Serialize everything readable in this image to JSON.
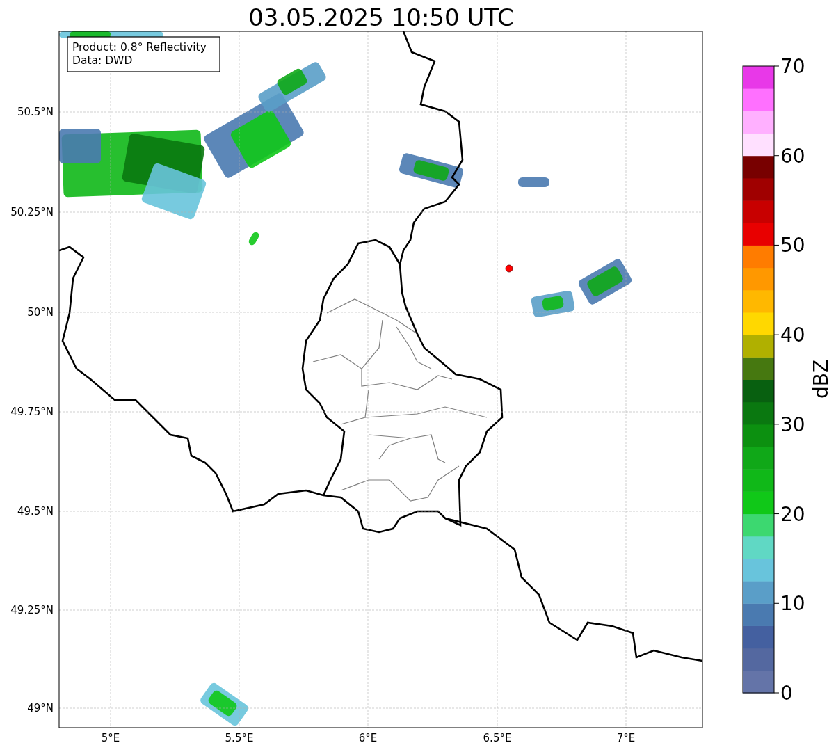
{
  "title": "03.05.2025 10:50 UTC",
  "info_box": [
    "Product: 0.8° Reflectivity",
    "Data: DWD"
  ],
  "lat_labels": [
    "50.5°N",
    "50.25°N",
    "50°N",
    "49.75°N",
    "49.5°N",
    "49.25°N",
    "49°N"
  ],
  "lon_labels": [
    "5°E",
    "5.5°E",
    "6°E",
    "6.5°E",
    "7°E"
  ],
  "colorbar": {
    "label": "dBZ",
    "ticks": [
      "70",
      "60",
      "50",
      "40",
      "30",
      "20",
      "10",
      "0"
    ],
    "steps": [
      {
        "color": "#6474a8"
      },
      {
        "color": "#5468a0"
      },
      {
        "color": "#4460a0"
      },
      {
        "color": "#4a7ab0"
      },
      {
        "color": "#5a9ec8"
      },
      {
        "color": "#68c4dc"
      },
      {
        "color": "#60d8c4"
      },
      {
        "color": "#3cd870"
      },
      {
        "color": "#10c818"
      },
      {
        "color": "#10b818"
      },
      {
        "color": "#10a818"
      },
      {
        "color": "#0c9010"
      },
      {
        "color": "#0a7810"
      },
      {
        "color": "#086010"
      },
      {
        "color": "#467810"
      },
      {
        "color": "#b0b000"
      },
      {
        "color": "#ffd800"
      },
      {
        "color": "#ffb800"
      },
      {
        "color": "#ff9800"
      },
      {
        "color": "#ff7c00"
      },
      {
        "color": "#e80000"
      },
      {
        "color": "#c80000"
      },
      {
        "color": "#a00000"
      },
      {
        "color": "#780000"
      },
      {
        "color": "#ffe0ff"
      },
      {
        "color": "#ffb0ff"
      },
      {
        "color": "#ff70ff"
      },
      {
        "color": "#e838e8"
      }
    ]
  }
}
